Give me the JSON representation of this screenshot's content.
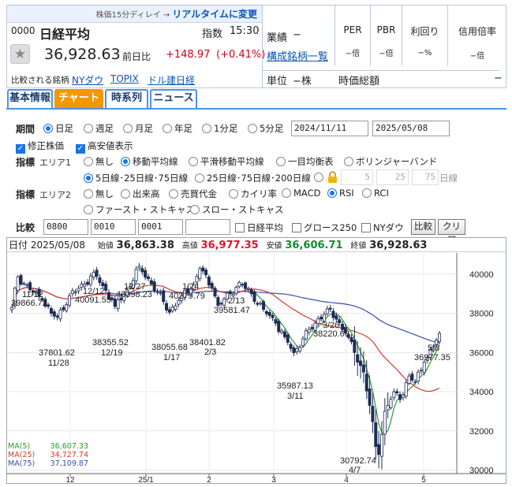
{
  "header": {
    "delay_note": "株価15分ディレイ →",
    "realtime_link": "リアルタイムに変更",
    "code": "0000",
    "name": "日経平均",
    "type_label": "指数",
    "time": "15:30",
    "price": "36,928.63",
    "change_label": "前日比",
    "change": "+148.97",
    "change_pct": "(+0.41%)",
    "compare_label": "比較される銘柄",
    "compare_links": [
      "NYダウ",
      "TOPIX",
      "ドル建日経"
    ],
    "gyoseki_label": "業績",
    "gyoseki_value": "−",
    "constituents_link": "構成銘柄一覧",
    "unit_label": "単位",
    "unit_value": "−株",
    "per_label": "PER",
    "per_value": "−倍",
    "pbr_label": "PBR",
    "pbr_value": "−倍",
    "yield_label": "利回り",
    "yield_value": "−%",
    "margin_label": "信用倍率",
    "margin_value": "−倍",
    "mcap_label": "時価総額",
    "mcap_value": "−"
  },
  "tabs": [
    "基本情報",
    "チャート",
    "時系列",
    "ニュース"
  ],
  "controls": {
    "period_label": "期間",
    "period_options": [
      "日足",
      "週足",
      "月足",
      "年足",
      "1分足",
      "5分足"
    ],
    "date_from": "2024/11/11",
    "date_to": "2025/05/08",
    "adjusted_label": "修正株価",
    "highlow_label": "高安値表示",
    "indicator_label": "指標",
    "area1_label": "エリア1",
    "area1_options": [
      "無し",
      "移動平均線",
      "平滑移動平均線",
      "一目均衡表",
      "ボリンジャーバンド"
    ],
    "ma_set_options": [
      "5日線･25日線･75日線",
      "25日線･75日線･200日線"
    ],
    "custom_ma": [
      "5",
      "25",
      "75"
    ],
    "custom_ma_unit": "日線",
    "area2_label": "エリア2",
    "area2_options": [
      "無し",
      "出来高",
      "売買代金",
      "カイリ率",
      "MACD",
      "RSI",
      "RCI"
    ],
    "area2_options_row2": [
      "ファースト・ストキャス",
      "スロー・ストキャス"
    ],
    "compare_label": "比較",
    "compare_codes": [
      "0800",
      "0010",
      "0001",
      ""
    ],
    "compare_checks": [
      "日経平均",
      "グロース250",
      "NYダウ"
    ],
    "compare_button": "比較",
    "clear_button": "クリア"
  },
  "ohlc": {
    "date_label": "日付",
    "date": "2025/05/08",
    "open_label": "始値",
    "open": "36,863.38",
    "high_label": "高値",
    "high": "36,977.35",
    "low_label": "安値",
    "low": "36,606.71",
    "close_label": "終値",
    "close": "36,928.63"
  },
  "legend": [
    {
      "name": "MA(5)",
      "value": "36,607.33",
      "color": "#2e9b2e"
    },
    {
      "name": "MA(25)",
      "value": "34,727.74",
      "color": "#d33b2c"
    },
    {
      "name": "MA(75)",
      "value": "37,109.87",
      "color": "#3a4bb0"
    }
  ],
  "chart_data": {
    "type": "candlestick",
    "y_ticks": [
      "40000",
      "38000",
      "36000",
      "34000",
      "32000",
      "30000"
    ],
    "ylim": [
      29900,
      41000
    ],
    "x_labels": [
      "12",
      "25/1",
      "2",
      "3",
      "4",
      "5"
    ],
    "annotations": [
      {
        "text": "11/12",
        "value": 39866.72
      },
      {
        "text": "39866.72",
        "value": 39866.72
      },
      {
        "text": "12/12",
        "value": 40091.55
      },
      {
        "text": "40091.55",
        "value": 40091.55
      },
      {
        "text": "12/27",
        "value": 40398.23
      },
      {
        "text": "40398.23",
        "value": 40398.23
      },
      {
        "text": "1/24",
        "value": 40279.79
      },
      {
        "text": "40279.79",
        "value": 40279.79
      },
      {
        "text": "2/13",
        "value": 39581.47
      },
      {
        "text": "39581.47",
        "value": 39581.47
      },
      {
        "text": "37801.62",
        "value": 37801.62
      },
      {
        "text": "11/28",
        "value": 37801.62
      },
      {
        "text": "38355.52",
        "value": 38355.52
      },
      {
        "text": "12/19",
        "value": 38355.52
      },
      {
        "text": "38055.68",
        "value": 38055.68
      },
      {
        "text": "1/17",
        "value": 38055.68
      },
      {
        "text": "38401.82",
        "value": 38401.82
      },
      {
        "text": "2/3",
        "value": 38401.82
      },
      {
        "text": "3/26",
        "value": 38220.69
      },
      {
        "text": "38220.69",
        "value": 38220.69
      },
      {
        "text": "35987.13",
        "value": 35987.13
      },
      {
        "text": "3/11",
        "value": 35987.13
      },
      {
        "text": "30792.74",
        "value": 30792.74
      },
      {
        "text": "4/7",
        "value": 30792.74
      },
      {
        "text": "5/8",
        "value": 36977.35
      },
      {
        "text": "36977.35",
        "value": 36977.35
      }
    ],
    "ma_colors": {
      "ma5": "#2e9b2e",
      "ma25": "#d33b2c",
      "ma75": "#3a4bb0"
    },
    "up_color": "#ffffff",
    "down_color": "#1f2d55"
  }
}
